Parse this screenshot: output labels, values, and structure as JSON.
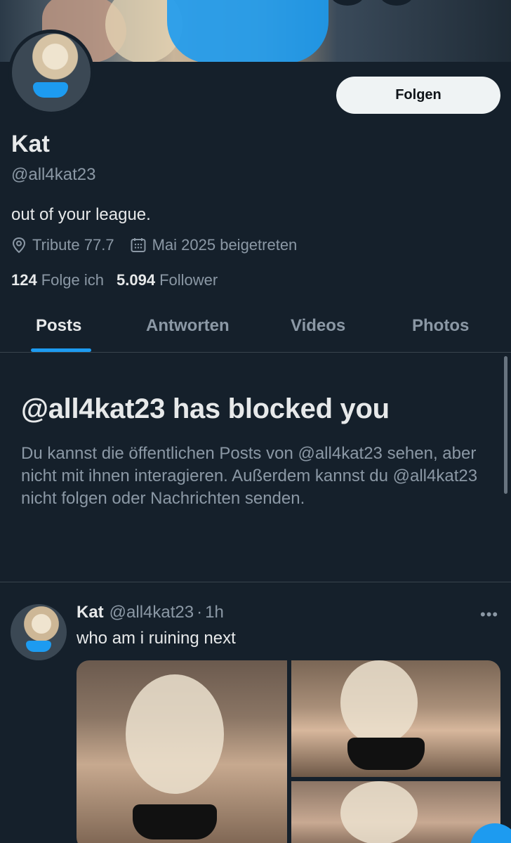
{
  "profile": {
    "name": "Kat",
    "handle": "@all4kat23",
    "bio": "out of your league.",
    "location": "Tribute 77.7",
    "joined": "Mai 2025 beigetreten",
    "following_count": "124",
    "following_label": "Folge ich",
    "followers_count": "5.094",
    "followers_label": "Follower",
    "follow_button": "Folgen"
  },
  "tabs": [
    {
      "label": "Posts",
      "active": true
    },
    {
      "label": "Antworten",
      "active": false
    },
    {
      "label": "Videos",
      "active": false
    },
    {
      "label": "Photos",
      "active": false
    }
  ],
  "blocked": {
    "title": "@all4kat23 has blocked you",
    "message": "Du kannst die öffentlichen Posts von @all4kat23 sehen, aber nicht mit ihnen interagieren. Außerdem kannst du @all4kat23 nicht folgen oder Nachrichten senden."
  },
  "tweet": {
    "name": "Kat",
    "handle": "@all4kat23",
    "separator": "·",
    "time": "1h",
    "text": "who am i ruining next",
    "more": "•••"
  },
  "colors": {
    "background": "#15202b",
    "accent": "#1d9bf0",
    "text_primary": "#e7e9ea",
    "text_secondary": "#8b98a5"
  },
  "icons": {
    "location": "location-pin-icon",
    "calendar": "calendar-icon",
    "more": "more-horizontal-icon"
  }
}
